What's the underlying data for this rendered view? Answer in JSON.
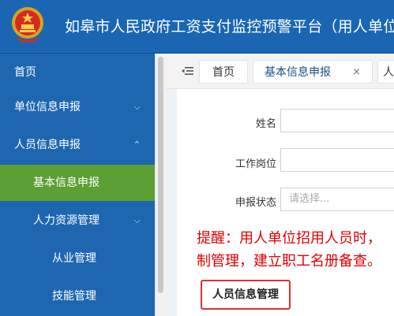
{
  "header": {
    "title": "如皋市人民政府工资支付监控预警平台（用人单位端",
    "emblem_icon": "national-emblem-icon"
  },
  "sidebar": {
    "items": [
      {
        "label": "首页",
        "chevron": ""
      },
      {
        "label": "单位信息申报",
        "chevron": "chevron-down-icon"
      },
      {
        "label": "人员信息申报",
        "chevron": "chevron-up-icon"
      },
      {
        "label": "基本信息申报",
        "chevron": ""
      },
      {
        "label": "人力资源管理",
        "chevron": "chevron-down-icon"
      },
      {
        "label": "从业管理",
        "chevron": ""
      },
      {
        "label": "技能管理",
        "chevron": ""
      }
    ]
  },
  "tabs": {
    "home": "首页",
    "basic": "基本信息申报",
    "basic_close": "×",
    "partial": "人"
  },
  "form": {
    "name_label": "姓名",
    "position_label": "工作岗位",
    "status_label": "申报状态",
    "status_placeholder": "请选择..."
  },
  "notice": {
    "line1": "提醒：用人单位招用人员时，",
    "line2": "制管理，建立职工名册备查。"
  },
  "section": {
    "title": "人员信息管理"
  },
  "colors": {
    "header_bg": "#1a66b3",
    "sidebar_bg": "#1e67b0",
    "active_item": "#5c9f34",
    "notice_red": "#e00000"
  }
}
